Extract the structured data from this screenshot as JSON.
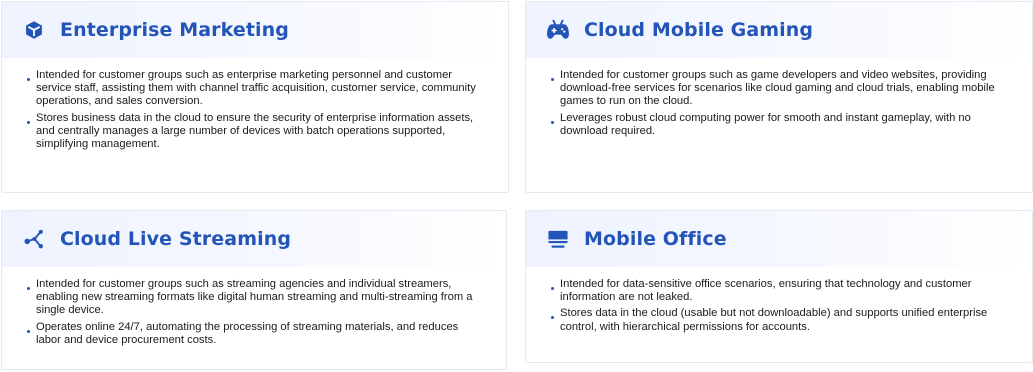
{
  "colors": {
    "accent": "#2355b8",
    "header_gradient_start": "#eef3ff",
    "border": "#e4e9f2",
    "text": "#1b1b1b"
  },
  "cards": [
    {
      "title": "Enterprise Marketing",
      "icon": "cube-icon",
      "bullets": [
        "Intended for customer groups such as enterprise marketing personnel and customer service staff, assisting them with channel traffic acquisition, customer service, community operations, and sales conversion.",
        "Stores business data in the cloud to ensure the security of enterprise information assets, and centrally manages a large number of devices with batch operations supported, simplifying management."
      ]
    },
    {
      "title": "Cloud Mobile Gaming",
      "icon": "gamepad-icon",
      "bullets": [
        "Intended for customer groups such as game developers and video websites, providing download-free services for scenarios like cloud gaming and cloud trials, enabling mobile games to run on the cloud.",
        "Leverages robust cloud computing power for smooth and instant gameplay, with no download required."
      ]
    },
    {
      "title": "Cloud Live Streaming",
      "icon": "share-nodes-icon",
      "bullets": [
        "Intended for customer groups such as streaming agencies and individual streamers, enabling new streaming formats like digital human streaming and multi-streaming from a single device.",
        "Operates online 24/7, automating the processing of streaming materials, and reduces labor and device procurement costs."
      ]
    },
    {
      "title": "Mobile Office",
      "icon": "monitor-icon",
      "bullets": [
        "Intended for data-sensitive office scenarios, ensuring that technology and customer information are not leaked.",
        "Stores data in the cloud (usable but not downloadable) and supports unified enterprise control, with hierarchical permissions for accounts."
      ]
    }
  ]
}
